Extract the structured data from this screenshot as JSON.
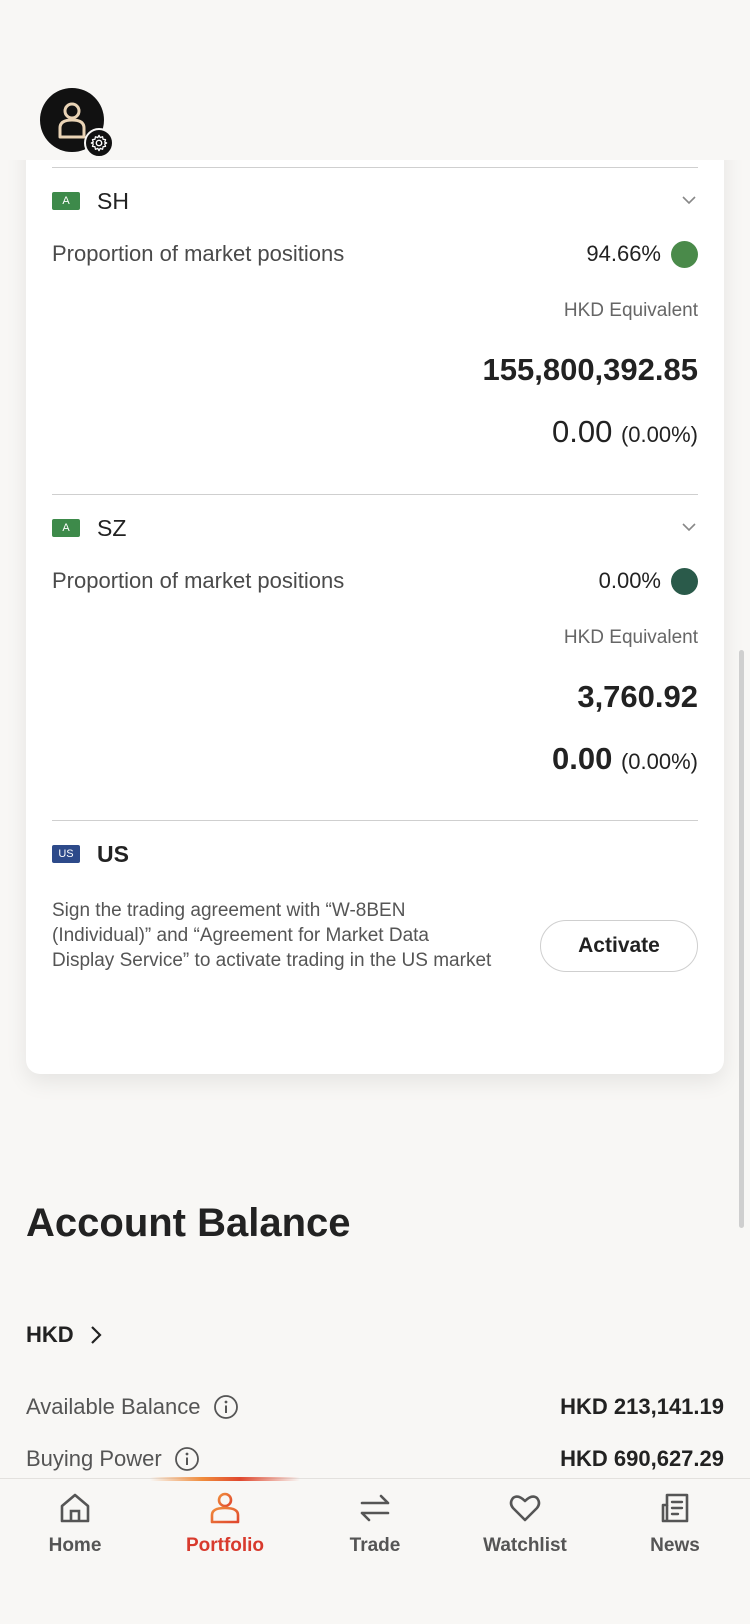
{
  "markets": [
    {
      "flag": "A",
      "flag_color": "#3d8a4a",
      "name": "SH",
      "proportion_label": "Proportion of market positions",
      "proportion": "94.66%",
      "dot_color": "#4a8a4a",
      "equiv_label": "HKD Equivalent",
      "equivalent": "155,800,392.85",
      "change": "0.00",
      "change_pct": "(0.00%)"
    },
    {
      "flag": "A",
      "flag_color": "#3d8a4a",
      "name": "SZ",
      "proportion_label": "Proportion of market positions",
      "proportion": "0.00%",
      "dot_color": "#2a5a4a",
      "equiv_label": "HKD Equivalent",
      "equivalent": "3,760.92",
      "change": "0.00",
      "change_pct": "(0.00%)"
    }
  ],
  "us_market": {
    "flag": "US",
    "flag_color": "#2d4a8a",
    "name": "US",
    "description": "Sign the trading agreement with “W-8BEN (Individual)” and “Agreement for Market Data Display Service” to activate trading in the US market",
    "activate_label": "Activate"
  },
  "account_balance": {
    "title": "Account Balance",
    "currency": "HKD",
    "rows": [
      {
        "label": "Available Balance",
        "value": "HKD 213,141.19"
      },
      {
        "label": "Buying Power",
        "value": "HKD 690,627.29"
      }
    ]
  },
  "nav": [
    {
      "label": "Home",
      "icon": "home-icon",
      "active": false
    },
    {
      "label": "Portfolio",
      "icon": "person-icon",
      "active": true
    },
    {
      "label": "Trade",
      "icon": "swap-arrows-icon",
      "active": false
    },
    {
      "label": "Watchlist",
      "icon": "heart-icon",
      "active": false
    },
    {
      "label": "News",
      "icon": "news-icon",
      "active": false
    }
  ],
  "colors": {
    "accent": "#d83a2d",
    "accent_gradient": "#f08c3c"
  }
}
